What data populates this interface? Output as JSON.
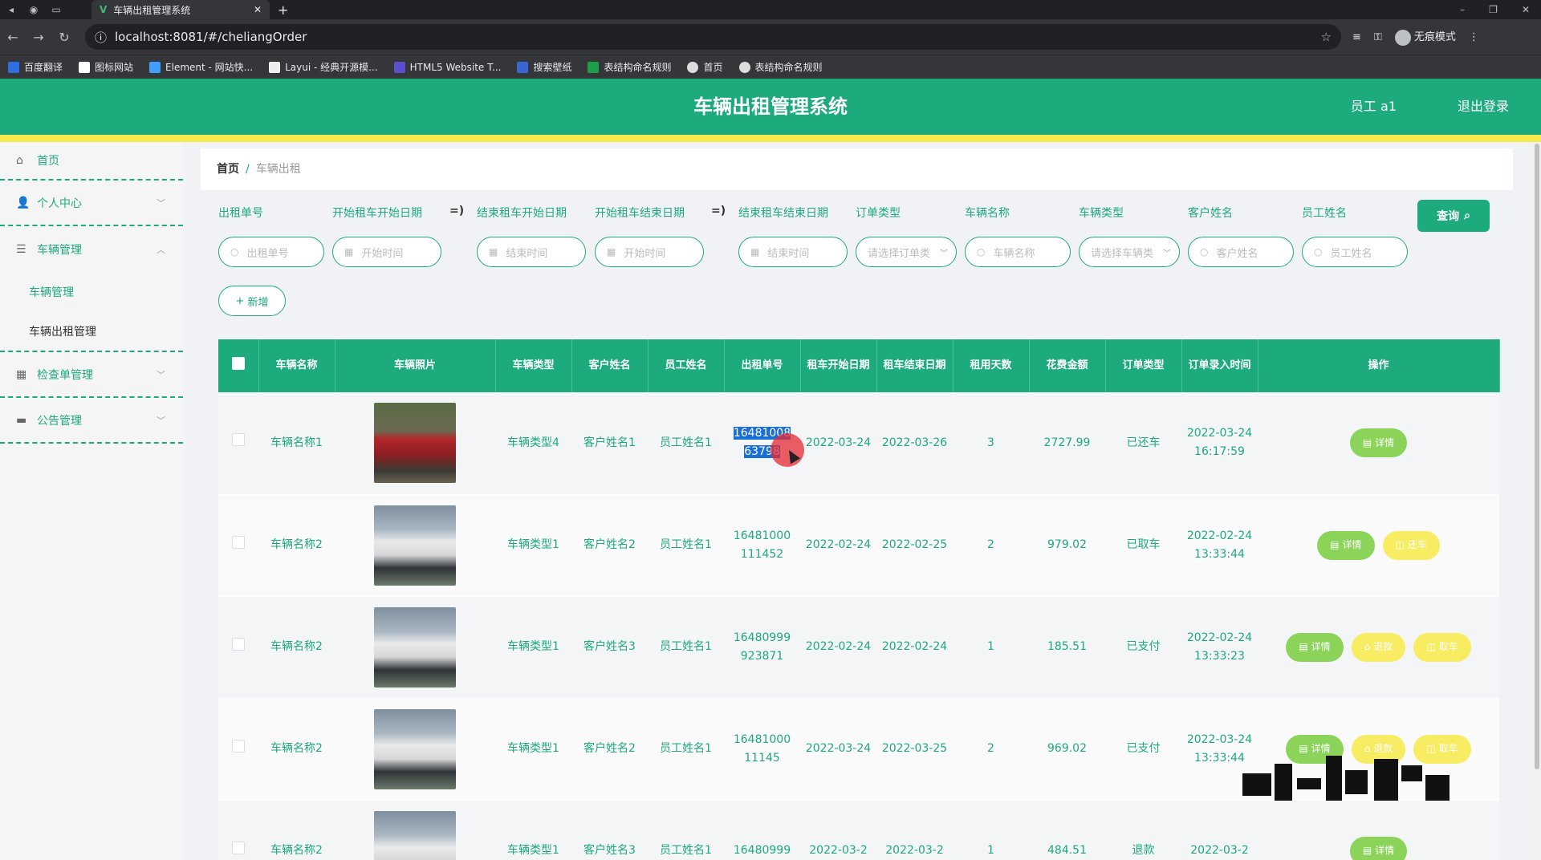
{
  "browser": {
    "tab_title": "车辆出租管理系统",
    "tab_close": "✕",
    "url": "localhost:8081/#/cheliangOrder",
    "profile_label": "无痕模式",
    "bookmarks": [
      "百度翻译",
      "图标网站",
      "Element - 网站快...",
      "Layui - 经典开源模...",
      "HTML5 Website T...",
      "搜索壁纸",
      "表结构命名规则",
      "首页",
      "表结构命名规则"
    ]
  },
  "header": {
    "title": "车辆出租管理系统",
    "user": "员工 a1",
    "logout": "退出登录"
  },
  "sidebar": {
    "items": [
      {
        "label": "首页",
        "icon": "⌂"
      },
      {
        "label": "个人中心",
        "icon": "👤"
      },
      {
        "label": "车辆管理",
        "icon": "☰"
      },
      {
        "label": "检查单管理",
        "icon": "▦"
      },
      {
        "label": "公告管理",
        "icon": "▬"
      }
    ],
    "sub_items": [
      "车辆管理",
      "车辆出租管理"
    ]
  },
  "breadcrumb": {
    "home": "首页",
    "sep": "/",
    "current": "车辆出租"
  },
  "filters": {
    "labels": [
      "出租单号",
      "开始租车开始日期",
      "结束租车开始日期",
      "开始租车结束日期",
      "结束租车结束日期",
      "订单类型",
      "车辆名称",
      "车辆类型",
      "客户姓名",
      "员工姓名"
    ],
    "range_symbol": "=)",
    "placeholders": [
      "出租单号",
      "开始时间",
      "结束时间",
      "开始时间",
      "结束时间",
      "请选择订单类",
      "车辆名称",
      "请选择车辆类",
      "客户姓名",
      "员工姓名"
    ],
    "query_button": "查询",
    "add_button": "新增"
  },
  "table": {
    "headers": [
      "车辆名称",
      "车辆照片",
      "车辆类型",
      "客户姓名",
      "员工姓名",
      "出租单号",
      "租车开始日期",
      "租车结束日期",
      "租用天数",
      "花费金额",
      "订单类型",
      "订单录入时间",
      "操作"
    ],
    "rows": [
      {
        "name": "车辆名称1",
        "photo": "red",
        "type": "车辆类型4",
        "customer": "客户姓名1",
        "staff": "员工姓名1",
        "order_no_a": "16481008",
        "order_no_b": "63798",
        "start": "2022-03-24",
        "end": "2022-03-26",
        "days": "3",
        "amount": "2727.99",
        "status": "已还车",
        "created": "2022-03-24 16:17:59",
        "actions": [
          "详情"
        ]
      },
      {
        "name": "车辆名称2",
        "photo": "white",
        "type": "车辆类型1",
        "customer": "客户姓名2",
        "staff": "员工姓名1",
        "order_no_a": "16481000",
        "order_no_b": "111452",
        "start": "2022-02-24",
        "end": "2022-02-25",
        "days": "2",
        "amount": "979.02",
        "status": "已取车",
        "created": "2022-02-24 13:33:44",
        "actions": [
          "详情",
          "还车"
        ]
      },
      {
        "name": "车辆名称2",
        "photo": "white",
        "type": "车辆类型1",
        "customer": "客户姓名3",
        "staff": "员工姓名1",
        "order_no_a": "16480999",
        "order_no_b": "923871",
        "start": "2022-02-24",
        "end": "2022-02-24",
        "days": "1",
        "amount": "185.51",
        "status": "已支付",
        "created": "2022-02-24 13:33:23",
        "actions": [
          "详情",
          "退款",
          "取车"
        ]
      },
      {
        "name": "车辆名称2",
        "photo": "white",
        "type": "车辆类型1",
        "customer": "客户姓名2",
        "staff": "员工姓名1",
        "order_no_a": "16481000",
        "order_no_b": "11145",
        "start": "2022-03-24",
        "end": "2022-03-25",
        "days": "2",
        "amount": "969.02",
        "status": "已支付",
        "created": "2022-03-24 13:33:44",
        "actions": [
          "详情",
          "退款",
          "取车"
        ]
      },
      {
        "name": "车辆名称2",
        "photo": "white",
        "type": "车辆类型1",
        "customer": "客户姓名3",
        "staff": "员工姓名1",
        "order_no_a": "16480999",
        "order_no_b": "",
        "start": "2022-03-2",
        "end": "2022-03-2",
        "days": "1",
        "amount": "484.51",
        "status": "退款",
        "created": "2022-03-2",
        "actions": [
          "详情"
        ]
      }
    ]
  },
  "colors": {
    "primary": "#1daa7c",
    "accent_yellow": "#f5e94e",
    "btn_green": "#8cd35a",
    "btn_yellow": "#f7ec62"
  }
}
